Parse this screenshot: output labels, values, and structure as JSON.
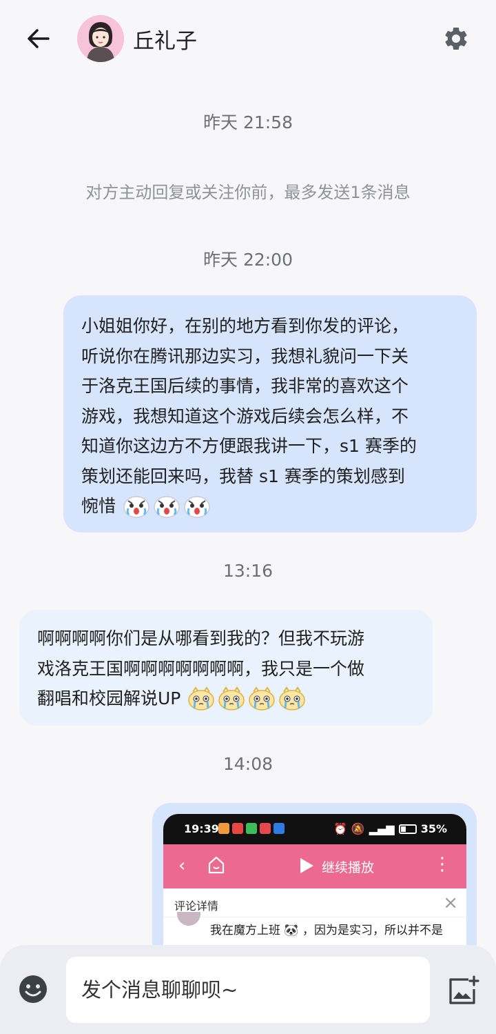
{
  "header": {
    "contact_name": "丘礼子"
  },
  "timestamps": {
    "t1": "昨天 21:58",
    "t2": "昨天 22:00",
    "t3": "13:16",
    "t4": "14:08"
  },
  "system_notice": "对方主动回复或关注你前，最多发送1条消息",
  "messages": [
    {
      "direction": "outgoing",
      "lines": [
        "小姐姐你好，在别的地方看到你发的评论，",
        "听说你在腾讯那边实习，我想礼貌问一下关",
        "于洛克王国后续的事情，我非常的喜欢这个",
        "游戏，我想知道这个游戏后续会怎么样，不",
        "知道你这边方不方便跟我讲一下，s1 赛季的",
        "策划还能回来吗，我替 s1 赛季的策划感到",
        "惋惜"
      ],
      "emoji": "crying-emoji"
    },
    {
      "direction": "incoming",
      "lines": [
        "啊啊啊啊你们是从哪看到我的？但我不玩游",
        "戏洛克王国啊啊啊啊啊啊啊，我只是一个做",
        "翻唱和校园解说UP"
      ],
      "emoji": "tearful-emoji"
    }
  ],
  "image_message": {
    "status_time": "19:39",
    "battery": "35%",
    "nav_label": "继续播放",
    "sub_title": "评论详情",
    "comment_text": "我在魔方上班",
    "comment_text_2": "，因为是实习，所以并不是"
  },
  "input": {
    "placeholder": "发个消息聊聊呗~"
  },
  "colors": {
    "outgoing_bubble": "#d7e5fc",
    "incoming_bubble": "#e9f2fd",
    "accent_pink": "#ec6a92"
  }
}
